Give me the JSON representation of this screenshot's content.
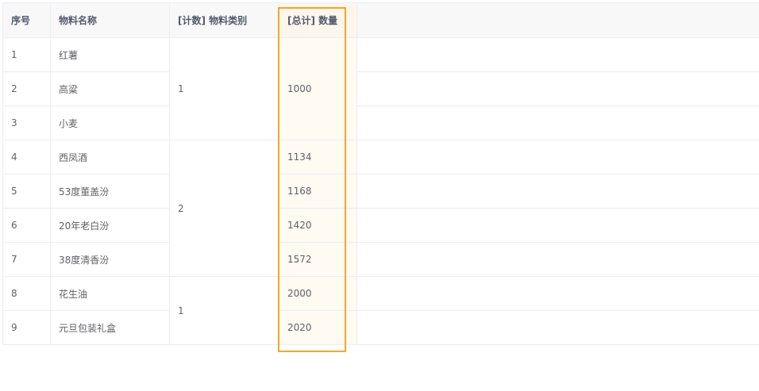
{
  "table": {
    "headers": {
      "index": "序号",
      "name": "物料名称",
      "category": "[计数] 物料类别",
      "quantity": "[总计] 数量"
    },
    "rows": [
      {
        "index": "1",
        "name": "红薯"
      },
      {
        "index": "2",
        "name": "高粱"
      },
      {
        "index": "3",
        "name": "小麦"
      },
      {
        "index": "4",
        "name": "西凤酒"
      },
      {
        "index": "5",
        "name": "53度董盖汾"
      },
      {
        "index": "6",
        "name": "20年老白汾"
      },
      {
        "index": "7",
        "name": "38度清香汾"
      },
      {
        "index": "8",
        "name": "花生油"
      },
      {
        "index": "9",
        "name": "元旦包装礼盒"
      }
    ],
    "category_groups": [
      {
        "value": "1",
        "rows": 3
      },
      {
        "value": "2",
        "rows": 4
      },
      {
        "value": "1",
        "rows": 2
      }
    ],
    "quantity_cells": [
      {
        "value": "1000",
        "rows": 3
      },
      {
        "value": "1134",
        "rows": 1
      },
      {
        "value": "1168",
        "rows": 1
      },
      {
        "value": "1420",
        "rows": 1
      },
      {
        "value": "1572",
        "rows": 1
      },
      {
        "value": "2000",
        "rows": 1
      },
      {
        "value": "2020",
        "rows": 1
      }
    ]
  },
  "colors": {
    "highlight_border": "#f5a623",
    "highlight_fill": "#fffaf2",
    "header_bg": "#f8f8f9",
    "border": "#ebeef5"
  }
}
